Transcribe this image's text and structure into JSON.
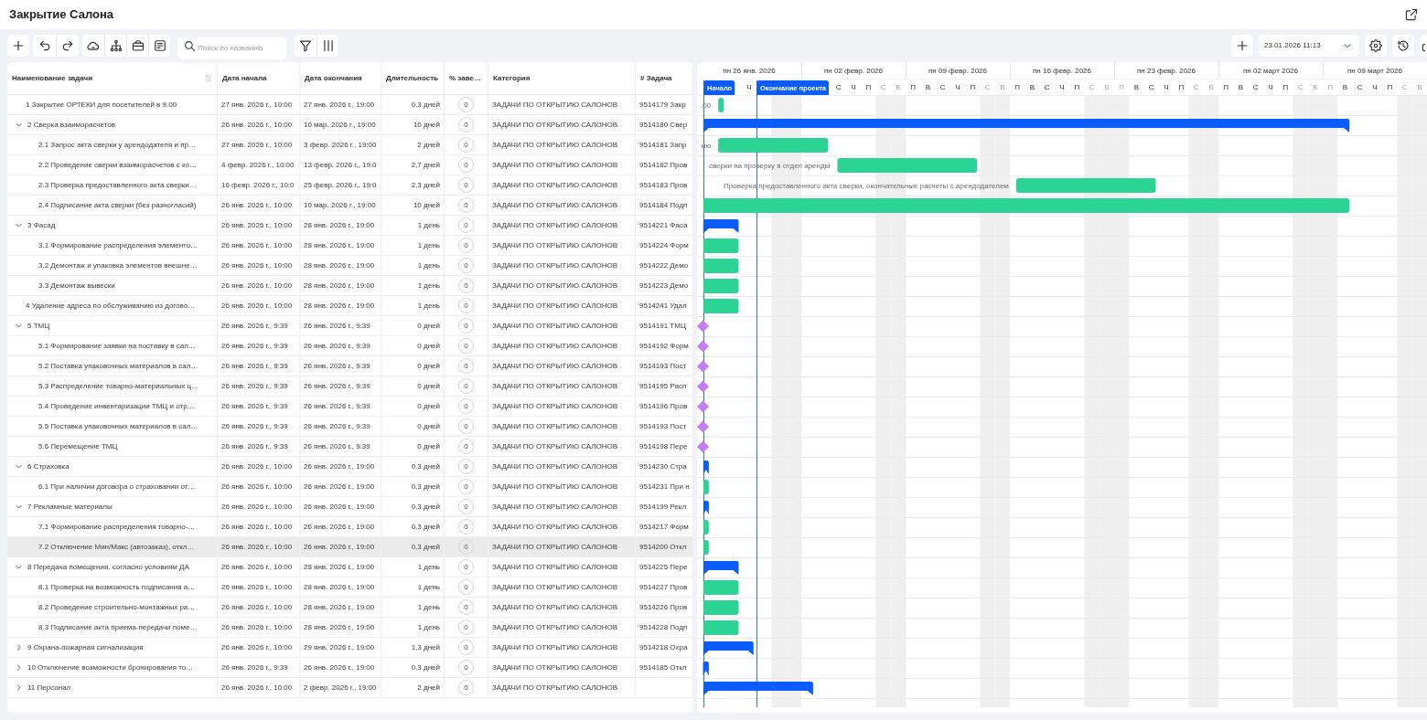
{
  "header": {
    "title": "Закрытие Салона"
  },
  "toolbar": {
    "search": {
      "placeholder": "Поиск по названию"
    },
    "date_picker": {
      "value": "23.01.2026 11:13"
    }
  },
  "table": {
    "columns": [
      "Наименование задачи",
      "Дата начала",
      "Дата окончания",
      "Длительность",
      "% заве…",
      "Категория",
      "# Задача"
    ],
    "rows": [
      {
        "name": "1 Закрытие ОРТЕКИ для посетителей в 9.00",
        "kind": "task",
        "selected": false,
        "start": "27 янв. 2026 г., 10:00",
        "end": "27 янв. 2026 г., 19:00",
        "duration": "0,3 дней",
        "percent": "0",
        "category": "ЗАДАЧИ ПО ОТКРЫТИЮ САЛОНОВ",
        "task": "9514179 Закр",
        "bar_label": ".00"
      },
      {
        "name": "2 Сверка взаиморасчетов",
        "kind": "summary",
        "expanded": true,
        "selected": false,
        "start": "26 янв. 2026 г., 10:00",
        "end": "10 мар. 2026 г., 19:00",
        "duration": "10 дней",
        "percent": "0",
        "category": "ЗАДАЧИ ПО ОТКРЫТИЮ САЛОНОВ",
        "task": "9514180 Свер",
        "children": [
          {
            "name": "2.1 Запрос акта сверки у арендодателя и пр…",
            "kind": "task",
            "selected": false,
            "start": "27 янв. 2026 г., 10:00",
            "end": "3 февр. 2026 г., 19:00",
            "duration": "2 дней",
            "percent": "0",
            "category": "ЗАДАЧИ ПО ОТКРЫТИЮ САЛОНОВ",
            "task": "9514181 Запр",
            "bar_label": "ию"
          },
          {
            "name": "2.2 Проведение сверки взаиморасчетов с ко…",
            "kind": "task",
            "selected": false,
            "start": "4 февр. 2026 г., 10:00",
            "end": "13 февр. 2026 г., 19:0",
            "duration": "2,7 дней",
            "percent": "0",
            "category": "ЗАДАЧИ ПО ОТКРЫТИЮ САЛОНОВ",
            "task": "9514182 Пров",
            "bar_label": "сверки на проверку в отдел аренды"
          },
          {
            "name": "2.3 Проверка предоставленного акта сверки…",
            "kind": "task",
            "selected": false,
            "start": "16 февр. 2026 г., 10:0",
            "end": "25 февр. 2026 г., 19:0",
            "duration": "2,3 дней",
            "percent": "0",
            "category": "ЗАДАЧИ ПО ОТКРЫТИЮ САЛОНОВ",
            "task": "9514183 Пров",
            "bar_label": "Проверка предоставленного акта сверки, окончательные расчеты с арендодателем"
          },
          {
            "name": "2.4 Подписание акта сверки (без разногласий)",
            "kind": "task",
            "selected": false,
            "start": "26 янв. 2026 г., 10:00",
            "end": "10 мар. 2026 г., 19:00",
            "duration": "10 дней",
            "percent": "0",
            "category": "ЗАДАЧИ ПО ОТКРЫТИЮ САЛОНОВ",
            "task": "9514184 Подп"
          }
        ]
      },
      {
        "name": "3 Фасад",
        "kind": "summary",
        "expanded": true,
        "selected": false,
        "start": "26 янв. 2026 г., 10:00",
        "end": "28 янв. 2026 г., 19:00",
        "duration": "1 день",
        "percent": "0",
        "category": "ЗАДАЧИ ПО ОТКРЫТИЮ САЛОНОВ",
        "task": "9514221 Фаса",
        "children": [
          {
            "name": "3.1 Формирование распределения элементо…",
            "kind": "task",
            "selected": false,
            "start": "26 янв. 2026 г., 10:00",
            "end": "28 янв. 2026 г., 19:00",
            "duration": "1 день",
            "percent": "0",
            "category": "ЗАДАЧИ ПО ОТКРЫТИЮ САЛОНОВ",
            "task": "9514224 Форм"
          },
          {
            "name": "3.2 Демонтаж и упаковка элементов внешне…",
            "kind": "task",
            "selected": false,
            "start": "26 янв. 2026 г., 10:00",
            "end": "28 янв. 2026 г., 19:00",
            "duration": "1 день",
            "percent": "0",
            "category": "ЗАДАЧИ ПО ОТКРЫТИЮ САЛОНОВ",
            "task": "9514222 Демо"
          },
          {
            "name": "3.3 Демонтаж вывески",
            "kind": "task",
            "selected": false,
            "start": "26 янв. 2026 г., 10:00",
            "end": "28 янв. 2026 г., 19:00",
            "duration": "1 день",
            "percent": "0",
            "category": "ЗАДАЧИ ПО ОТКРЫТИЮ САЛОНОВ",
            "task": "9514223 Демо"
          }
        ]
      },
      {
        "name": "4 Удаление адреса по обслуживанию из догово…",
        "kind": "task",
        "selected": false,
        "start": "26 янв. 2026 г., 10:00",
        "end": "28 янв. 2026 г., 19:00",
        "duration": "1 день",
        "percent": "0",
        "category": "ЗАДАЧИ ПО ОТКРЫТИЮ САЛОНОВ",
        "task": "9514241 Удал"
      },
      {
        "name": "5 ТМЦ",
        "kind": "summary",
        "expanded": true,
        "selected": false,
        "start": "26 янв. 2026 г., 9:39",
        "end": "26 янв. 2026 г., 9:39",
        "duration": "0 дней",
        "percent": "0",
        "category": "ЗАДАЧИ ПО ОТКРЫТИЮ САЛОНОВ",
        "task": "9514191 ТМЦ",
        "children": [
          {
            "name": "5.1 Формирование заявки на поставку в сал…",
            "kind": "task",
            "selected": false,
            "start": "26 янв. 2026 г., 9:39",
            "end": "26 янв. 2026 г., 9:39",
            "duration": "0 дней",
            "percent": "0",
            "category": "ЗАДАЧИ ПО ОТКРЫТИЮ САЛОНОВ",
            "task": "9514192 Форм"
          },
          {
            "name": "5.2 Поставка упаковочных материалов в сал…",
            "kind": "task",
            "selected": false,
            "start": "26 янв. 2026 г., 9:39",
            "end": "26 янв. 2026 г., 9:39",
            "duration": "0 дней",
            "percent": "0",
            "category": "ЗАДАЧИ ПО ОТКРЫТИЮ САЛОНОВ",
            "task": "9514193 Пост"
          },
          {
            "name": "5.3 Распределение товарно-материальных ц…",
            "kind": "task",
            "selected": false,
            "start": "26 янв. 2026 г., 9:39",
            "end": "26 янв. 2026 г., 9:39",
            "duration": "0 дней",
            "percent": "0",
            "category": "ЗАДАЧИ ПО ОТКРЫТИЮ САЛОНОВ",
            "task": "9514195 Расп"
          },
          {
            "name": "5.4 Проведение инвентаризации ТМЦ и отр…",
            "kind": "task",
            "selected": false,
            "start": "26 янв. 2026 г., 9:39",
            "end": "26 янв. 2026 г., 9:39",
            "duration": "0 дней",
            "percent": "0",
            "category": "ЗАДАЧИ ПО ОТКРЫТИЮ САЛОНОВ",
            "task": "9514196 Пров"
          },
          {
            "name": "5.5 Поставка упаковочных материалов в сал…",
            "kind": "task",
            "selected": false,
            "start": "26 янв. 2026 г., 9:39",
            "end": "26 янв. 2026 г., 9:39",
            "duration": "0 дней",
            "percent": "0",
            "category": "ЗАДАЧИ ПО ОТКРЫТИЮ САЛОНОВ",
            "task": "9514193 Пост"
          },
          {
            "name": "5.6 Перемещение ТМЦ",
            "kind": "task",
            "selected": false,
            "start": "26 янв. 2026 г., 9:39",
            "end": "26 янв. 2026 г., 9:39",
            "duration": "0 дней",
            "percent": "0",
            "category": "ЗАДАЧИ ПО ОТКРЫТИЮ САЛОНОВ",
            "task": "9514198 Пере"
          }
        ]
      },
      {
        "name": "6 Страховка",
        "kind": "summary",
        "expanded": true,
        "selected": false,
        "start": "26 янв. 2026 г., 10:00",
        "end": "26 янв. 2026 г., 19:00",
        "duration": "0,3 дней",
        "percent": "0",
        "category": "ЗАДАЧИ ПО ОТКРЫТИЮ САЛОНОВ",
        "task": "9514230 Стра",
        "children": [
          {
            "name": "6.1 При наличии договора о страховании от…",
            "kind": "task",
            "selected": false,
            "start": "26 янв. 2026 г., 10:00",
            "end": "26 янв. 2026 г., 19:00",
            "duration": "0,3 дней",
            "percent": "0",
            "category": "ЗАДАЧИ ПО ОТКРЫТИЮ САЛОНОВ",
            "task": "9514231 При н"
          }
        ]
      },
      {
        "name": "7 Рекламные материалы",
        "kind": "summary",
        "expanded": true,
        "selected": false,
        "start": "26 янв. 2026 г., 10:00",
        "end": "26 янв. 2026 г., 19:00",
        "duration": "0,3 дней",
        "percent": "0",
        "category": "ЗАДАЧИ ПО ОТКРЫТИЮ САЛОНОВ",
        "task": "9514199 Рекл",
        "children": [
          {
            "name": "7.1 Формирование распределения товарно-…",
            "kind": "task",
            "selected": false,
            "start": "26 янв. 2026 г., 10:00",
            "end": "26 янв. 2026 г., 19:00",
            "duration": "0,3 дней",
            "percent": "0",
            "category": "ЗАДАЧИ ПО ОТКРЫТИЮ САЛОНОВ",
            "task": "9514217 Форм"
          },
          {
            "name": "7.2 Отключение Мин/Макс (автозаказ), откл…",
            "kind": "task",
            "selected": true,
            "start": "26 янв. 2026 г., 10:00",
            "end": "26 янв. 2026 г., 19:00",
            "duration": "0,3 дней",
            "percent": "0",
            "category": "ЗАДАЧИ ПО ОТКРЫТИЮ САЛОНОВ",
            "task": "9514200 Откл"
          }
        ]
      },
      {
        "name": "8 Передача помещения, согласно условиям ДА",
        "kind": "summary",
        "expanded": true,
        "selected": false,
        "start": "26 янв. 2026 г., 10:00",
        "end": "28 янв. 2026 г., 19:00",
        "duration": "1 день",
        "percent": "0",
        "category": "ЗАДАЧИ ПО ОТКРЫТИЮ САЛОНОВ",
        "task": "9514225 Пере",
        "children": [
          {
            "name": "8.1 Проверка на возможность подписания а…",
            "kind": "task",
            "selected": false,
            "start": "26 янв. 2026 г., 10:00",
            "end": "28 янв. 2026 г., 19:00",
            "duration": "1 день",
            "percent": "0",
            "category": "ЗАДАЧИ ПО ОТКРЫТИЮ САЛОНОВ",
            "task": "9514227 Пров"
          },
          {
            "name": "8.2 Проведение строительно-монтажных ра…",
            "kind": "task",
            "selected": false,
            "start": "26 янв. 2026 г., 10:00",
            "end": "28 янв. 2026 г., 19:00",
            "duration": "1 день",
            "percent": "0",
            "category": "ЗАДАЧИ ПО ОТКРЫТИЮ САЛОНОВ",
            "task": "9514226 Пров"
          },
          {
            "name": "8.3 Подписание акта приема-передачи поме…",
            "kind": "task",
            "selected": false,
            "start": "26 янв. 2026 г., 10:00",
            "end": "28 янв. 2026 г., 19:00",
            "duration": "1 день",
            "percent": "0",
            "category": "ЗАДАЧИ ПО ОТКРЫТИЮ САЛОНОВ",
            "task": "9514228 Подп"
          }
        ]
      },
      {
        "name": "9 Охрана-пожарная сигнализация",
        "kind": "summary",
        "expanded": false,
        "selected": false,
        "start": "26 янв. 2026 г., 10:00",
        "end": "29 янв. 2026 г., 19:00",
        "duration": "1,3 дней",
        "percent": "0",
        "category": "ЗАДАЧИ ПО ОТКРЫТИЮ САЛОНОВ",
        "task": "9514218 Охра"
      },
      {
        "name": "10 Отключение возможности бронирования то…",
        "kind": "summary",
        "expanded": false,
        "selected": false,
        "start": "26 янв. 2026 г., 9:39",
        "end": "26 янв. 2026 г., 19:00",
        "duration": "0,3 дней",
        "percent": "0",
        "category": "ЗАДАЧИ ПО ОТКРЫТИЮ САЛОНОВ",
        "task": "9514185 Откл"
      },
      {
        "name": "11 Персонал",
        "kind": "summary",
        "expanded": false,
        "selected": false,
        "start": "26 янв. 2026 г., 10:00",
        "end": "2 февр. 2026 г., 19:00",
        "duration": "2 дней",
        "percent": "0",
        "category": "ЗАДАЧИ ПО ОТКРЫТИЮ САЛОНОВ"
      }
    ]
  },
  "gantt": {
    "weeks": [
      "пн 26 янв. 2026",
      "пн 02 февр. 2026",
      "пн 09 февр. 2026",
      "пн 16 февр. 2026",
      "пн 23 февр. 2026",
      "пн 02 март 2026",
      "пн 09 март 2026"
    ],
    "days": [
      {
        "weekend": false
      },
      {
        "weekend": false
      },
      {
        "weekend": false
      },
      {
        "label": "Ч",
        "weekend": false
      },
      {
        "weekend": false
      },
      {
        "weekend": true
      },
      {
        "weekend": true
      },
      {
        "weekend": false
      },
      {
        "weekend": false
      },
      {
        "label": "С",
        "weekend": false
      },
      {
        "label": "Ч",
        "weekend": false
      },
      {
        "label": "П",
        "weekend": false
      },
      {
        "label": "С",
        "weekend": true
      },
      {
        "label": "В",
        "weekend": true
      },
      {
        "label": "П",
        "weekend": false
      },
      {
        "label": "В",
        "weekend": false
      },
      {
        "label": "С",
        "weekend": false
      },
      {
        "label": "Ч",
        "weekend": false
      },
      {
        "label": "П",
        "weekend": false
      },
      {
        "label": "С",
        "weekend": true
      },
      {
        "label": "В",
        "weekend": true
      },
      {
        "label": "П",
        "weekend": false
      },
      {
        "label": "В",
        "weekend": false
      },
      {
        "label": "С",
        "weekend": false
      },
      {
        "label": "Ч",
        "weekend": false
      },
      {
        "label": "П",
        "weekend": false
      },
      {
        "label": "С",
        "weekend": true
      },
      {
        "label": "В",
        "weekend": true
      },
      {
        "label": "П",
        "weekend": true
      },
      {
        "label": "В",
        "weekend": false
      },
      {
        "label": "С",
        "weekend": false
      },
      {
        "label": "Ч",
        "weekend": false
      },
      {
        "label": "П",
        "weekend": false
      },
      {
        "label": "С",
        "weekend": true
      },
      {
        "label": "В",
        "weekend": true
      },
      {
        "label": "П",
        "weekend": false
      },
      {
        "label": "В",
        "weekend": false
      },
      {
        "label": "С",
        "weekend": false
      },
      {
        "label": "Ч",
        "weekend": false
      },
      {
        "label": "П",
        "weekend": false
      },
      {
        "label": "С",
        "weekend": true
      },
      {
        "label": "В",
        "weekend": true
      },
      {
        "label": "П",
        "weekend": true
      },
      {
        "label": "В",
        "weekend": false
      },
      {
        "label": "С",
        "weekend": false
      },
      {
        "label": "Ч",
        "weekend": false
      },
      {
        "label": "П",
        "weekend": false
      },
      {
        "label": "С",
        "weekend": true
      },
      {
        "label": "В",
        "weekend": true
      }
    ],
    "markers": [
      "Начало",
      "Окончание проекта"
    ]
  }
}
